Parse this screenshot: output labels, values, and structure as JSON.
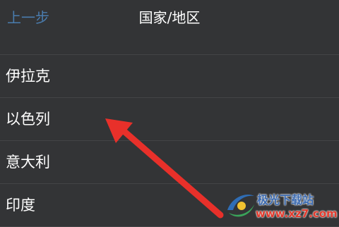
{
  "header": {
    "back_label": "上一步",
    "title": "国家/地区"
  },
  "list": {
    "items": [
      {
        "label": "伊拉克"
      },
      {
        "label": "以色列"
      },
      {
        "label": "意大利"
      },
      {
        "label": "印度"
      }
    ]
  },
  "annotation": {
    "arrow_color": "#e8302a",
    "arrow_icon": "red-arrow-icon"
  },
  "watermark": {
    "brand": "极光下载站",
    "url": "www.xz7.com",
    "logo_icon": "swoosh-logo-icon"
  },
  "colors": {
    "background": "#333436",
    "back_link": "#4a7cae",
    "text": "#ffffff",
    "divider": "#444547"
  }
}
